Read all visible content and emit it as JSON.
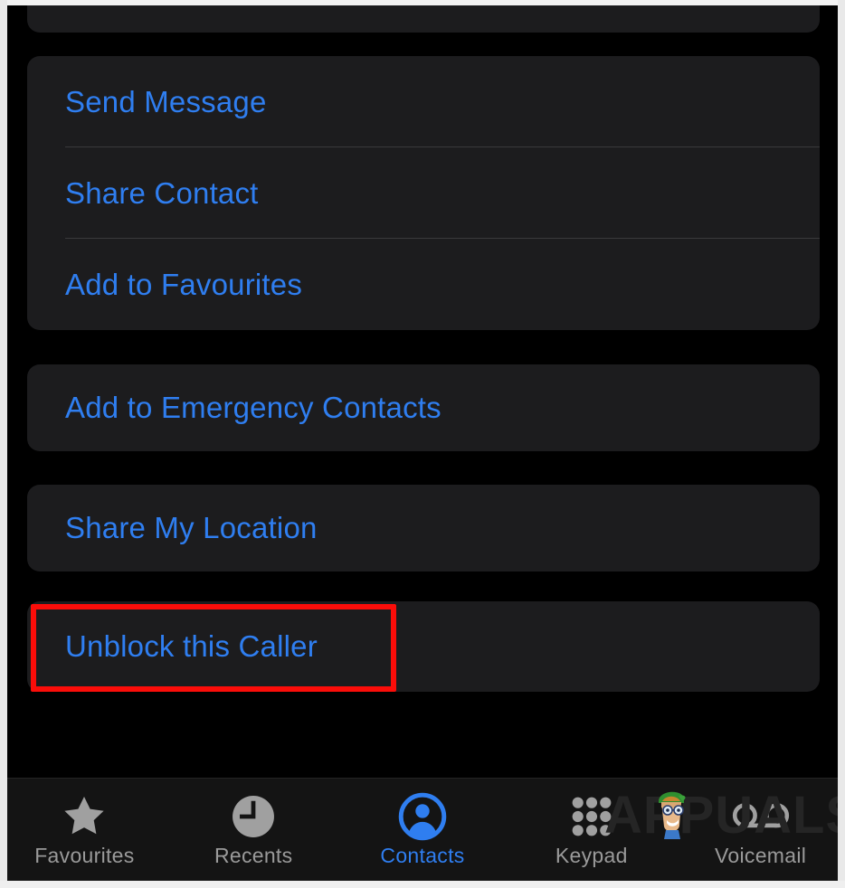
{
  "screen": {
    "app": "Phone",
    "background_color": "#000000",
    "card_color": "#1c1c1e",
    "accent_color": "#2f7ef0",
    "separator_color": "#3a3a3c",
    "inactive_color": "#9a9a9a"
  },
  "annotation": {
    "kind": "highlight-box",
    "color": "#fb0d09",
    "targets": "unblock-this-caller-row"
  },
  "groups": [
    {
      "name": "partial-card-top",
      "rows": []
    },
    {
      "name": "primary-actions",
      "rows": [
        {
          "label": "Send Message"
        },
        {
          "label": "Share Contact"
        },
        {
          "label": "Add to Favourites"
        }
      ]
    },
    {
      "name": "emergency",
      "rows": [
        {
          "label": "Add to Emergency Contacts"
        }
      ]
    },
    {
      "name": "location",
      "rows": [
        {
          "label": "Share My Location"
        }
      ]
    },
    {
      "name": "block",
      "rows": [
        {
          "label": "Unblock this Caller"
        }
      ]
    }
  ],
  "tabbar": {
    "tabs": [
      {
        "label": "Favourites",
        "icon": "star-icon",
        "active": false
      },
      {
        "label": "Recents",
        "icon": "clock-icon",
        "active": false
      },
      {
        "label": "Contacts",
        "icon": "contacts-icon",
        "active": true
      },
      {
        "label": "Keypad",
        "icon": "keypad-icon",
        "active": false
      },
      {
        "label": "Voicemail",
        "icon": "voicemail-icon",
        "active": false
      }
    ]
  },
  "watermark": {
    "text": "APPUALS",
    "color": "#252525"
  }
}
